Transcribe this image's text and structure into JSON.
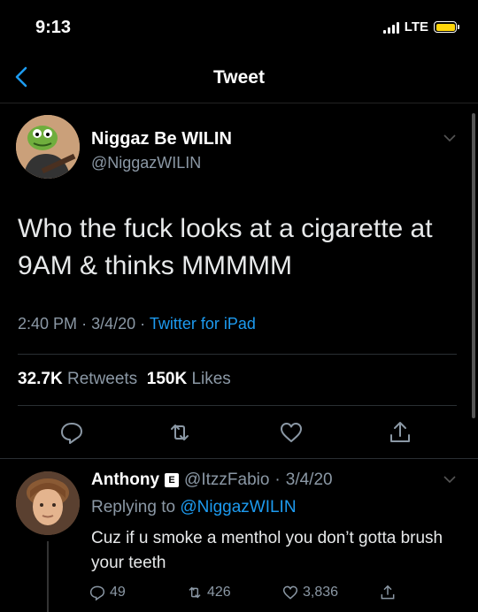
{
  "status_bar": {
    "time": "9:13",
    "network": "LTE"
  },
  "nav": {
    "title": "Tweet"
  },
  "tweet": {
    "author_name": "Niggaz Be WILIN",
    "author_handle": "@NiggazWILIN",
    "text": "Who the fuck looks at a cigarette at 9AM & thinks MMMMM",
    "time": "2:40 PM",
    "date_sep": "·",
    "date": "3/4/20",
    "source_sep": "·",
    "source": "Twitter for iPad",
    "retweets": "32.7K",
    "retweets_label": "Retweets",
    "likes": "150K",
    "likes_label": "Likes"
  },
  "reply": {
    "author_name": "Anthony",
    "badge": "E",
    "author_handle": "@ItzzFabio",
    "date_sep": "·",
    "date": "3/4/20",
    "replying_label": "Replying to",
    "replying_handle": "@NiggazWILIN",
    "text": "Cuz if u smoke a menthol you don’t gotta brush your teeth",
    "replies": "49",
    "retweets": "426",
    "likes": "3,836"
  },
  "colors": {
    "accent": "#1d9bf0",
    "muted": "#8b98a5",
    "background": "#000000"
  },
  "icons": [
    "back-chevron-icon",
    "reply-icon",
    "retweet-icon",
    "like-icon",
    "share-icon",
    "chevron-down-icon"
  ]
}
